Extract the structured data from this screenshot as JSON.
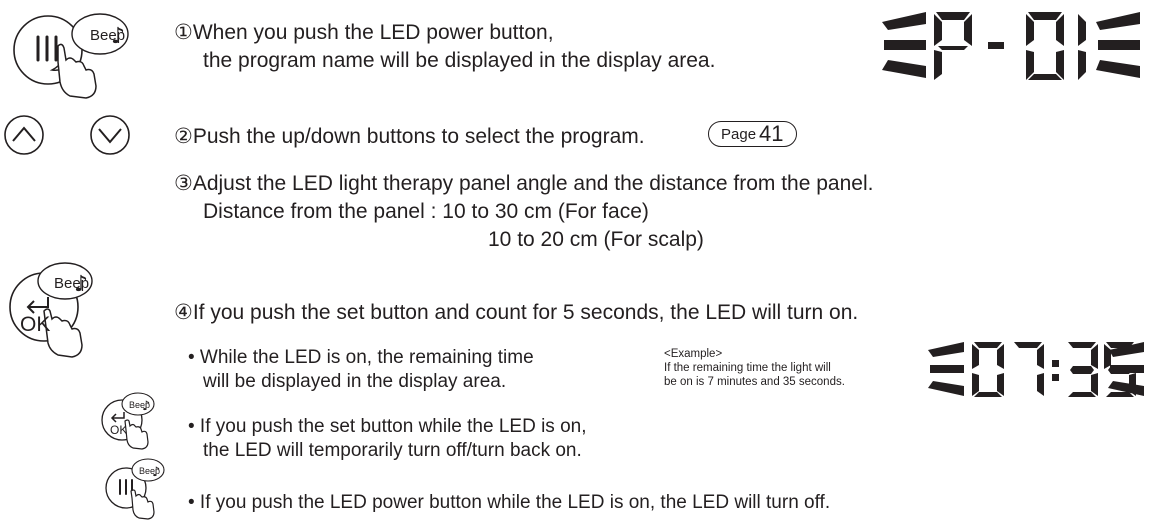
{
  "icons": {
    "beep_label": "Beep",
    "ok_label": "OK"
  },
  "step1": {
    "line1": "①When you push the LED power button,",
    "line2": "the program name will be displayed in the display area.",
    "display": "P-01"
  },
  "step2": {
    "text": "②Push the up/down buttons to select the program.",
    "page_ref_prefix": "Page",
    "page_ref_number": "41"
  },
  "step3": {
    "line1": "③Adjust the LED light therapy panel angle and the distance from the panel.",
    "line2": "Distance from the panel : 10 to 30 cm (For face)",
    "line3": "10 to 20 cm (For scalp)"
  },
  "step4": {
    "text": "④If you push the set button and count for 5 seconds, the LED will turn on.",
    "bullet1_line1": "• While the LED is on, the remaining time",
    "bullet1_line2": "will be displayed in the display area.",
    "example_title": "<Example>",
    "example_line1": "If the remaining time the light will",
    "example_line2": "be on is 7 minutes and 35 seconds.",
    "display": "07:35",
    "bullet2_line1": "• If you push the set button while the LED is on,",
    "bullet2_line2": "the LED will temporarily turn off/turn back on.",
    "bullet3": "• If you push the LED power button while the LED is on, the LED will turn off."
  }
}
